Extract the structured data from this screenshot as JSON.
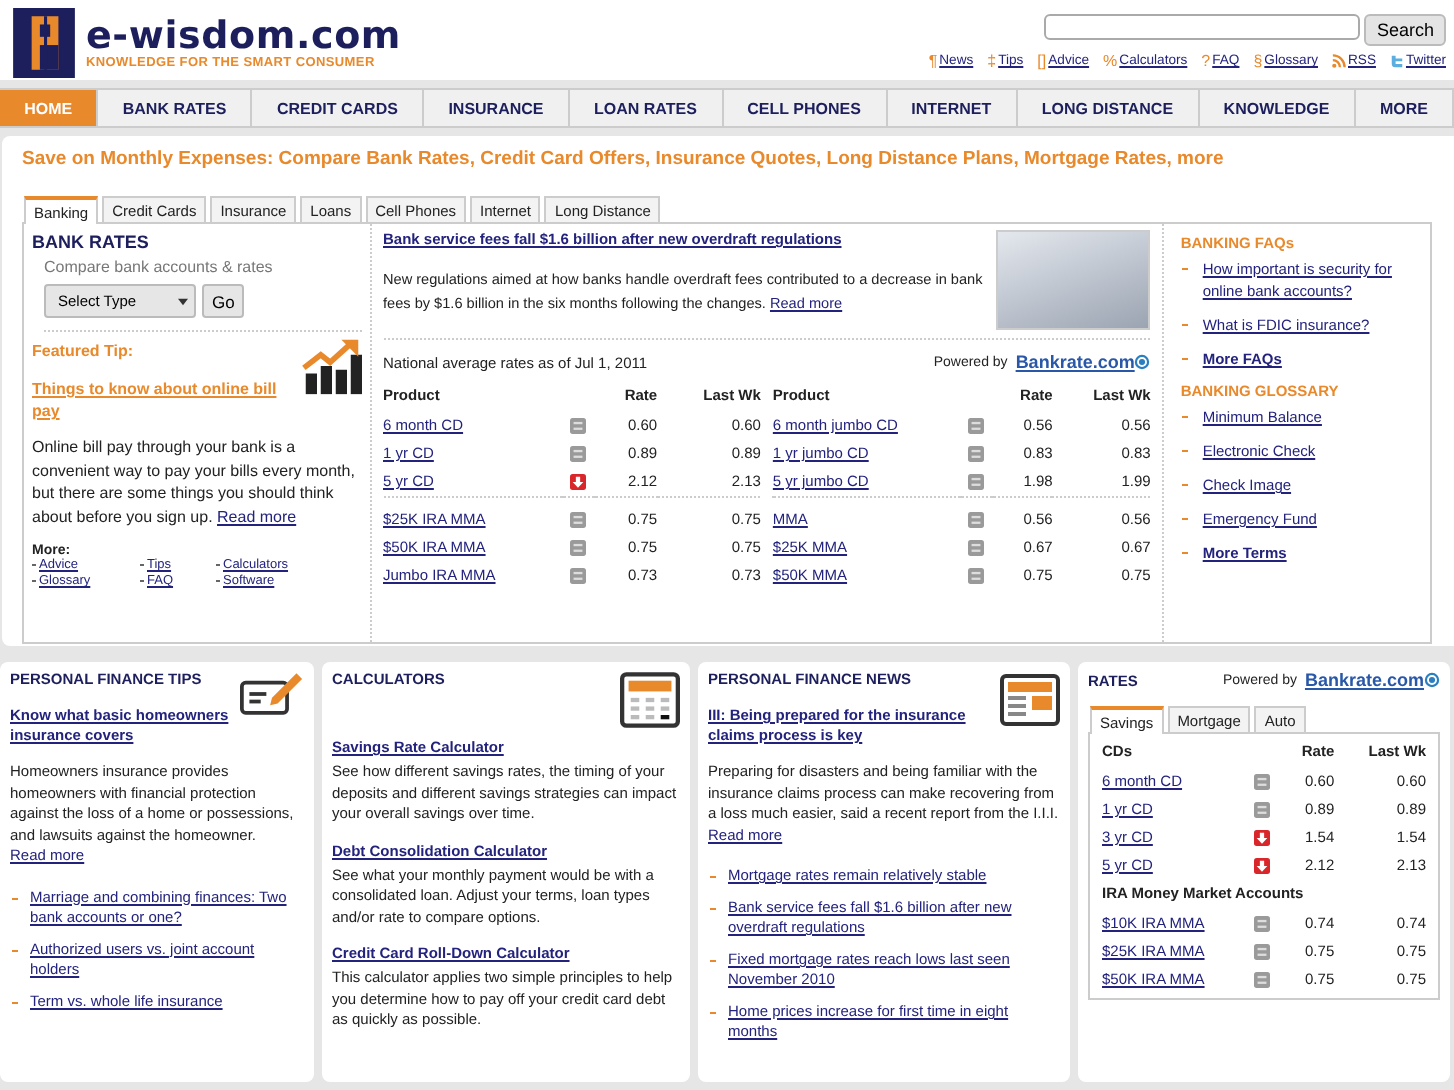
{
  "logo": {
    "name": "e-wisdom.com",
    "tagline": "KNOWLEDGE FOR THE SMART CONSUMER"
  },
  "search": {
    "button": "Search"
  },
  "top_links": [
    {
      "kind": "symbol",
      "symbol": "¶",
      "label": "News"
    },
    {
      "kind": "symbol",
      "symbol": "‡",
      "label": "Tips"
    },
    {
      "kind": "symbol",
      "symbol": "[]",
      "label": "Advice"
    },
    {
      "kind": "symbol",
      "symbol": "%",
      "label": "Calculators"
    },
    {
      "kind": "symbol",
      "symbol": "?",
      "label": "FAQ"
    },
    {
      "kind": "symbol",
      "symbol": "§",
      "label": "Glossary"
    },
    {
      "kind": "rss",
      "label": "RSS"
    },
    {
      "kind": "twitter",
      "label": "Twitter"
    }
  ],
  "nav": [
    {
      "label": "HOME",
      "selected": true
    },
    {
      "label": "BANK RATES",
      "selected": false
    },
    {
      "label": "CREDIT CARDS",
      "selected": false
    },
    {
      "label": "INSURANCE",
      "selected": false
    },
    {
      "label": "LOAN RATES",
      "selected": false
    },
    {
      "label": "CELL PHONES",
      "selected": false
    },
    {
      "label": "INTERNET",
      "selected": false
    },
    {
      "label": "LONG DISTANCE",
      "selected": false
    },
    {
      "label": "KNOWLEDGE",
      "selected": false
    },
    {
      "label": "MORE",
      "selected": false
    }
  ],
  "headline": "Save on Monthly Expenses: Compare Bank Rates, Credit Card Offers, Insurance Quotes, Long Distance Plans, Mortgage Rates, more",
  "tabs": [
    {
      "label": "Banking",
      "selected": true
    },
    {
      "label": "Credit Cards",
      "selected": false
    },
    {
      "label": "Insurance",
      "selected": false
    },
    {
      "label": "Loans",
      "selected": false
    },
    {
      "label": "Cell Phones",
      "selected": false
    },
    {
      "label": "Internet",
      "selected": false
    },
    {
      "label": "Long Distance",
      "selected": false
    }
  ],
  "bank_rates": {
    "title": "BANK RATES",
    "subtitle": "Compare bank accounts & rates",
    "select": "Select Type",
    "go": "Go"
  },
  "featured_tip": {
    "heading": "Featured Tip:",
    "title": "Things to know about online bill pay",
    "body": "Online bill pay through your bank is a convenient way to pay your bills every month, but there are some things you should think about before you sign up.",
    "read_more": "Read more"
  },
  "more": {
    "heading": "More:",
    "links": [
      "Advice",
      "Tips",
      "Calculators",
      "Glossary",
      "FAQ",
      "Software"
    ]
  },
  "article": {
    "title": "Bank service fees fall $1.6 billion after new overdraft regulations",
    "body": "New regulations aimed at how banks handle overdraft fees contributed to a decrease in bank fees by $1.6 billion in the six months following the changes.",
    "read_more": "Read more"
  },
  "rates_table": {
    "as_of": "National average rates as of Jul 1, 2011",
    "powered_by": "Powered by",
    "source": "Bankrate.com",
    "halves": [
      {
        "columns": [
          "Product",
          "Rate",
          "Last Wk"
        ],
        "groups": [
          [
            {
              "product": "6 month CD",
              "down": false,
              "rate": "0.60",
              "last_wk": "0.60"
            },
            {
              "product": "1 yr CD",
              "down": false,
              "rate": "0.89",
              "last_wk": "0.89"
            },
            {
              "product": "5 yr CD",
              "down": true,
              "rate": "2.12",
              "last_wk": "2.13"
            }
          ],
          [
            {
              "product": "$25K IRA MMA",
              "down": false,
              "rate": "0.75",
              "last_wk": "0.75"
            },
            {
              "product": "$50K IRA MMA",
              "down": false,
              "rate": "0.75",
              "last_wk": "0.75"
            },
            {
              "product": "Jumbo IRA MMA",
              "down": false,
              "rate": "0.73",
              "last_wk": "0.73"
            }
          ]
        ]
      },
      {
        "columns": [
          "Product",
          "Rate",
          "Last Wk"
        ],
        "groups": [
          [
            {
              "product": "6 month jumbo CD",
              "down": false,
              "rate": "0.56",
              "last_wk": "0.56"
            },
            {
              "product": "1 yr jumbo CD",
              "down": false,
              "rate": "0.83",
              "last_wk": "0.83"
            },
            {
              "product": "5 yr jumbo CD",
              "down": false,
              "rate": "1.98",
              "last_wk": "1.99"
            }
          ],
          [
            {
              "product": "MMA",
              "down": false,
              "rate": "0.56",
              "last_wk": "0.56"
            },
            {
              "product": "$25K MMA",
              "down": false,
              "rate": "0.67",
              "last_wk": "0.67"
            },
            {
              "product": "$50K MMA",
              "down": false,
              "rate": "0.75",
              "last_wk": "0.75"
            }
          ]
        ]
      }
    ]
  },
  "faqs": {
    "title": "BANKING FAQs",
    "links": [
      {
        "label": "How important is security for online bank accounts?",
        "bold": false
      },
      {
        "label": "What is FDIC insurance?",
        "bold": false
      },
      {
        "label": "More FAQs",
        "bold": true
      }
    ]
  },
  "glossary": {
    "title": "BANKING GLOSSARY",
    "links": [
      {
        "label": "Minimum Balance",
        "bold": false
      },
      {
        "label": "Electronic Check",
        "bold": false
      },
      {
        "label": "Check Image",
        "bold": false
      },
      {
        "label": "Emergency Fund",
        "bold": false
      },
      {
        "label": "More Terms",
        "bold": true
      }
    ]
  },
  "tips": {
    "title": "PERSONAL FINANCE TIPS",
    "article_title": "Know what basic homeowners insurance covers",
    "body": "Homeowners insurance provides homeowners with financial protection against the loss of a home or possessions, and lawsuits against the homeowner.",
    "read_more": "Read more",
    "links": [
      "Marriage and combining finances: Two bank accounts or one?",
      "Authorized users vs. joint account holders",
      "Term vs. whole life insurance"
    ]
  },
  "calculators": {
    "title": "CALCULATORS",
    "items": [
      {
        "title": "Savings Rate Calculator",
        "body": "See how different savings rates, the timing of your deposits and different savings strategies can impact your overall savings over time."
      },
      {
        "title": "Debt Consolidation Calculator",
        "body": "See what your monthly payment would be with a consolidated loan. Adjust your terms, loan types and/or rate to compare options."
      },
      {
        "title": "Credit Card Roll-Down Calculator",
        "body": "This calculator applies two simple principles to help you determine how to pay off your credit card debt as quickly as possible."
      }
    ]
  },
  "news": {
    "title": "PERSONAL FINANCE NEWS",
    "article_title": "III: Being prepared for the insurance claims process is key",
    "body": "Preparing for disasters and being familiar with the insurance claims process can make recovering from a loss much easier, said a recent report from the I.I.I.",
    "read_more": "Read more",
    "links": [
      "Mortgage rates remain relatively stable",
      "Bank service fees fall $1.6 billion after new overdraft regulations",
      "Fixed mortgage rates reach lows last seen November 2010",
      "Home prices increase for first time in eight months"
    ]
  },
  "rates": {
    "title": "RATES",
    "powered_by": "Powered by",
    "source": "Bankrate.com",
    "tabs": [
      {
        "label": "Savings",
        "selected": true
      },
      {
        "label": "Mortgage",
        "selected": false
      },
      {
        "label": "Auto",
        "selected": false
      }
    ],
    "columns": [
      "CDs",
      "Rate",
      "Last Wk"
    ],
    "rows": [
      {
        "product": "6 month CD",
        "down": false,
        "rate": "0.60",
        "last_wk": "0.60"
      },
      {
        "product": "1 yr CD",
        "down": false,
        "rate": "0.89",
        "last_wk": "0.89"
      },
      {
        "product": "3 yr CD",
        "down": true,
        "rate": "1.54",
        "last_wk": "1.54"
      },
      {
        "product": "5 yr CD",
        "down": true,
        "rate": "2.12",
        "last_wk": "2.13"
      }
    ],
    "section": "IRA Money Market Accounts",
    "section_rows": [
      {
        "product": "$10K IRA MMA",
        "down": false,
        "rate": "0.74",
        "last_wk": "0.74"
      },
      {
        "product": "$25K IRA MMA",
        "down": false,
        "rate": "0.75",
        "last_wk": "0.75"
      },
      {
        "product": "$50K IRA MMA",
        "down": false,
        "rate": "0.75",
        "last_wk": "0.75"
      }
    ]
  }
}
